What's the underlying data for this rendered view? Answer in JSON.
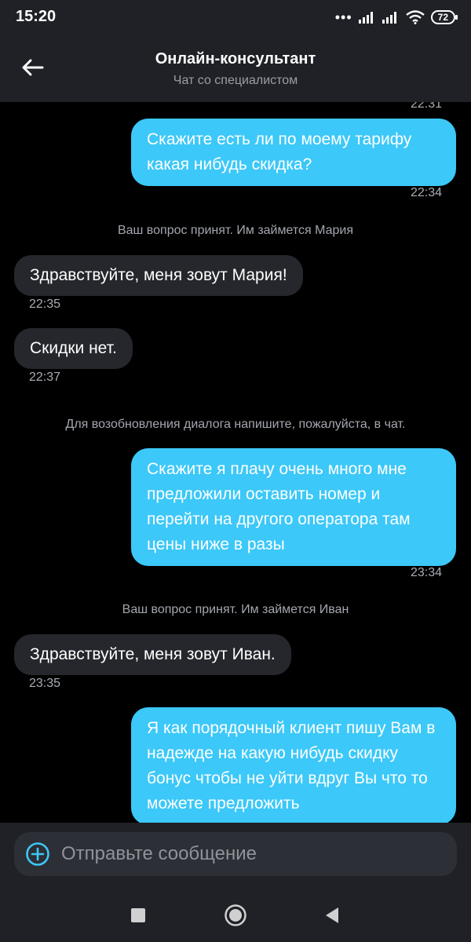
{
  "status_bar": {
    "time": "15:20",
    "dots": "•••",
    "battery": "72",
    "icons": [
      "signal-icon",
      "signal-icon",
      "wifi-icon",
      "battery-icon"
    ]
  },
  "header": {
    "title": "Онлайн-консультант",
    "subtitle": "Чат со специалистом",
    "back_icon": "arrow-left-icon"
  },
  "messages": {
    "top_time": "22:31",
    "m1": {
      "text": "Скажите есть ли по моему тарифу какая нибудь скидка?",
      "time": "22:34"
    },
    "sys1": "Ваш вопрос принят. Им займется Мария",
    "m2": {
      "text": "Здравствуйте, меня зовут Мария!",
      "time": "22:35"
    },
    "m3": {
      "text": "Скидки нет.",
      "time": "22:37"
    },
    "sys2": "Для возобновления диалога напишите, пожалуйста, в чат.",
    "m4": {
      "text": "Скажите я плачу очень много мне предложили оставить номер и перейти на другого оператора там цены ниже в разы",
      "time": "23:34"
    },
    "sys3": "Ваш вопрос принят. Им займется Иван",
    "m5": {
      "text": "Здравствуйте, меня зовут Иван.",
      "time": "23:35"
    },
    "m6": {
      "text": "Я как порядочный клиент пишу Вам в надежде на какую нибудь скидку бонус чтобы не уйти вдруг Вы что то можете предложить"
    }
  },
  "composer": {
    "placeholder": "Отправьте сообщение",
    "add_icon": "plus-circle-icon"
  },
  "nav": {
    "icons": [
      "square-icon",
      "circle-icon",
      "triangle-back-icon"
    ]
  },
  "colors": {
    "outgoing_bubble": "#3cc8f8",
    "incoming_bubble": "#25272c",
    "header_bg": "#1f2126",
    "chat_bg": "#000000",
    "accent": "#3cc8f8"
  }
}
